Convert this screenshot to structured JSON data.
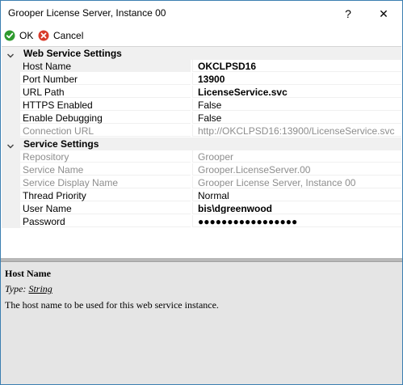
{
  "window": {
    "title": "Grooper License Server, Instance 00",
    "help_button": "?",
    "close_button": "✕"
  },
  "toolbar": {
    "ok_label": "OK",
    "cancel_label": "Cancel",
    "ok_color": "#2e9a2e",
    "cancel_color": "#d83a2a"
  },
  "categories": [
    {
      "label": "Web Service Settings",
      "properties": [
        {
          "name": "Host Name",
          "value": "OKCLPSD16",
          "bold": true,
          "disabled": false,
          "selected": true
        },
        {
          "name": "Port Number",
          "value": "13900",
          "bold": true,
          "disabled": false
        },
        {
          "name": "URL Path",
          "value": "LicenseService.svc",
          "bold": true,
          "disabled": false
        },
        {
          "name": "HTTPS Enabled",
          "value": "False",
          "bold": false,
          "disabled": false
        },
        {
          "name": "Enable Debugging",
          "value": "False",
          "bold": false,
          "disabled": false
        },
        {
          "name": "Connection URL",
          "value": "http://OKCLPSD16:13900/LicenseService.svc",
          "bold": false,
          "disabled": true
        }
      ]
    },
    {
      "label": "Service Settings",
      "properties": [
        {
          "name": "Repository",
          "value": "Grooper",
          "bold": false,
          "disabled": true
        },
        {
          "name": "Service Name",
          "value": "Grooper.LicenseServer.00",
          "bold": false,
          "disabled": true
        },
        {
          "name": "Service Display Name",
          "value": "Grooper License Server, Instance 00",
          "bold": false,
          "disabled": true
        },
        {
          "name": "Thread Priority",
          "value": "Normal",
          "bold": false,
          "disabled": false
        },
        {
          "name": "User Name",
          "value": "bis\\dgreenwood",
          "bold": true,
          "disabled": false
        },
        {
          "name": "Password",
          "value": "●●●●●●●●●●●●●●●●●",
          "bold": false,
          "disabled": false
        }
      ]
    }
  ],
  "help": {
    "title": "Host Name",
    "type_label": "Type:",
    "type_value": "String",
    "description": "The host name to be used for this web service instance."
  }
}
